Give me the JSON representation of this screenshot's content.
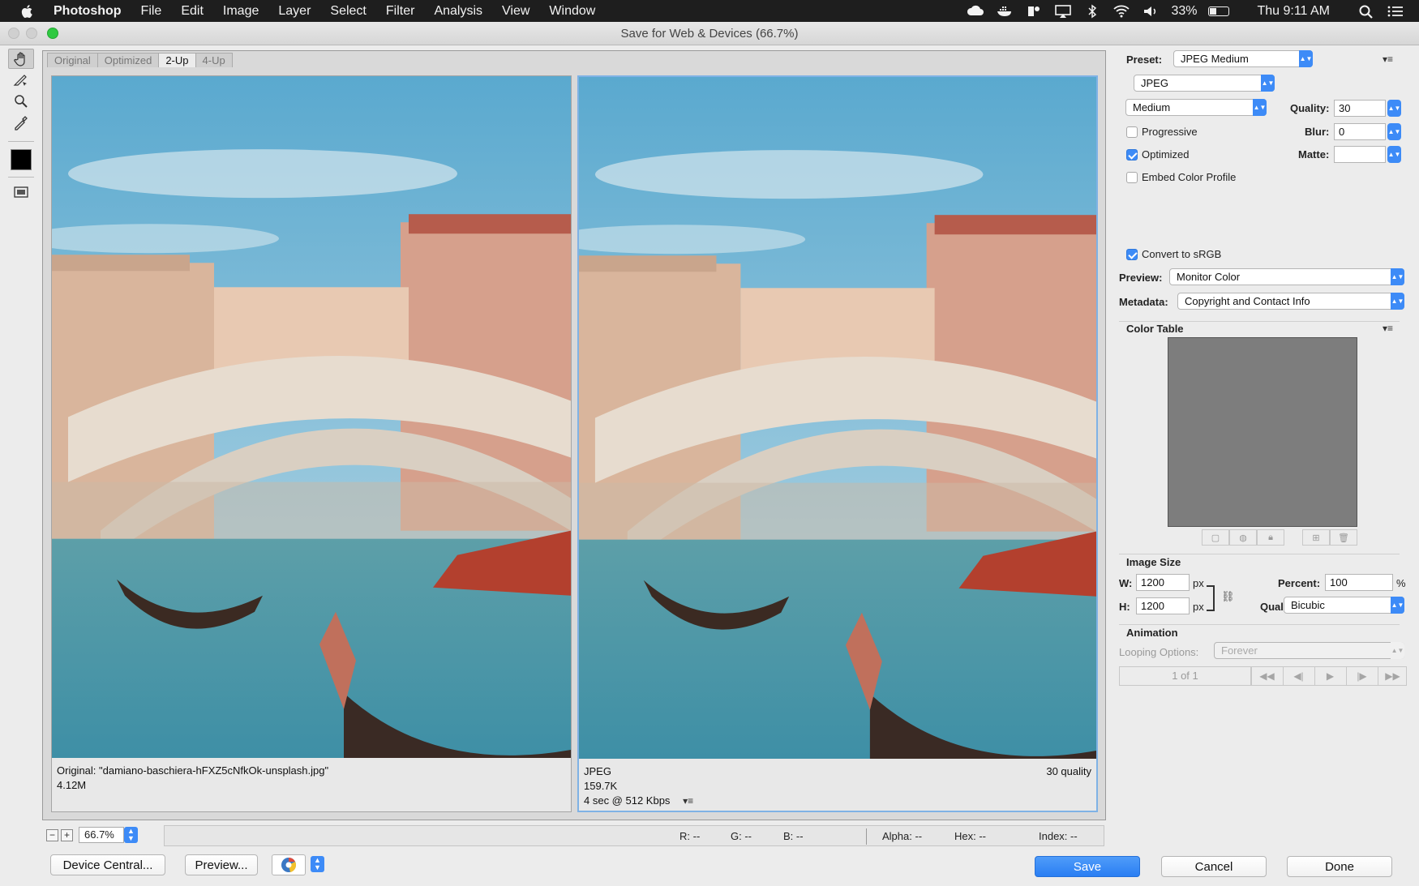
{
  "menubar": {
    "app_name": "Photoshop",
    "items": [
      "File",
      "Edit",
      "Image",
      "Layer",
      "Select",
      "Filter",
      "Analysis",
      "View",
      "Window"
    ],
    "battery": "33%",
    "clock": "Thu 9:11 AM",
    "battery_level": 0.33
  },
  "window": {
    "title": "Save for Web & Devices (66.7%)"
  },
  "tabs": [
    "Original",
    "Optimized",
    "2-Up",
    "4-Up"
  ],
  "active_tab": "2-Up",
  "left_pane": {
    "line1": "Original: \"damiano-baschiera-hFXZ5cNfkOk-unsplash.jpg\"",
    "line2": "4.12M"
  },
  "right_pane": {
    "format": "JPEG",
    "quality_note": "30 quality",
    "size": "159.7K",
    "download": "4 sec @ 512 Kbps"
  },
  "status": {
    "zoom": "66.7%",
    "r": "R: --",
    "g": "G: --",
    "b": "B: --",
    "alpha": "Alpha: --",
    "hex": "Hex: --",
    "index": "Index: --"
  },
  "buttons": {
    "device_central": "Device Central...",
    "preview": "Preview...",
    "save": "Save",
    "cancel": "Cancel",
    "done": "Done"
  },
  "settings": {
    "preset_label": "Preset:",
    "preset_value": "JPEG Medium",
    "format_value": "JPEG",
    "compression_value": "Medium",
    "quality_label": "Quality:",
    "quality_value": "30",
    "progressive_label": "Progressive",
    "progressive_checked": false,
    "blur_label": "Blur:",
    "blur_value": "0",
    "optimized_label": "Optimized",
    "optimized_checked": true,
    "matte_label": "Matte:",
    "matte_value": "",
    "embed_label": "Embed Color Profile",
    "embed_checked": false,
    "srgb_label": "Convert to sRGB",
    "srgb_checked": true,
    "preview_label": "Preview:",
    "preview_value": "Monitor Color",
    "metadata_label": "Metadata:",
    "metadata_value": "Copyright and Contact Info",
    "color_table_label": "Color Table"
  },
  "image_size": {
    "heading": "Image Size",
    "w_label": "W:",
    "w_value": "1200",
    "h_label": "H:",
    "h_value": "1200",
    "unit": "px",
    "percent_label": "Percent:",
    "percent_value": "100",
    "percent_unit": "%",
    "quality_label": "Quality:",
    "quality_value": "Bicubic"
  },
  "animation": {
    "heading": "Animation",
    "looping_label": "Looping Options:",
    "looping_value": "Forever",
    "frame_counter": "1 of 1"
  },
  "colors": {
    "accent": "#3d8bf7",
    "menubar": "#1e1e1e",
    "selected_pane_border": "#7fb2e5",
    "color_table_fill": "#7d7d7d"
  }
}
